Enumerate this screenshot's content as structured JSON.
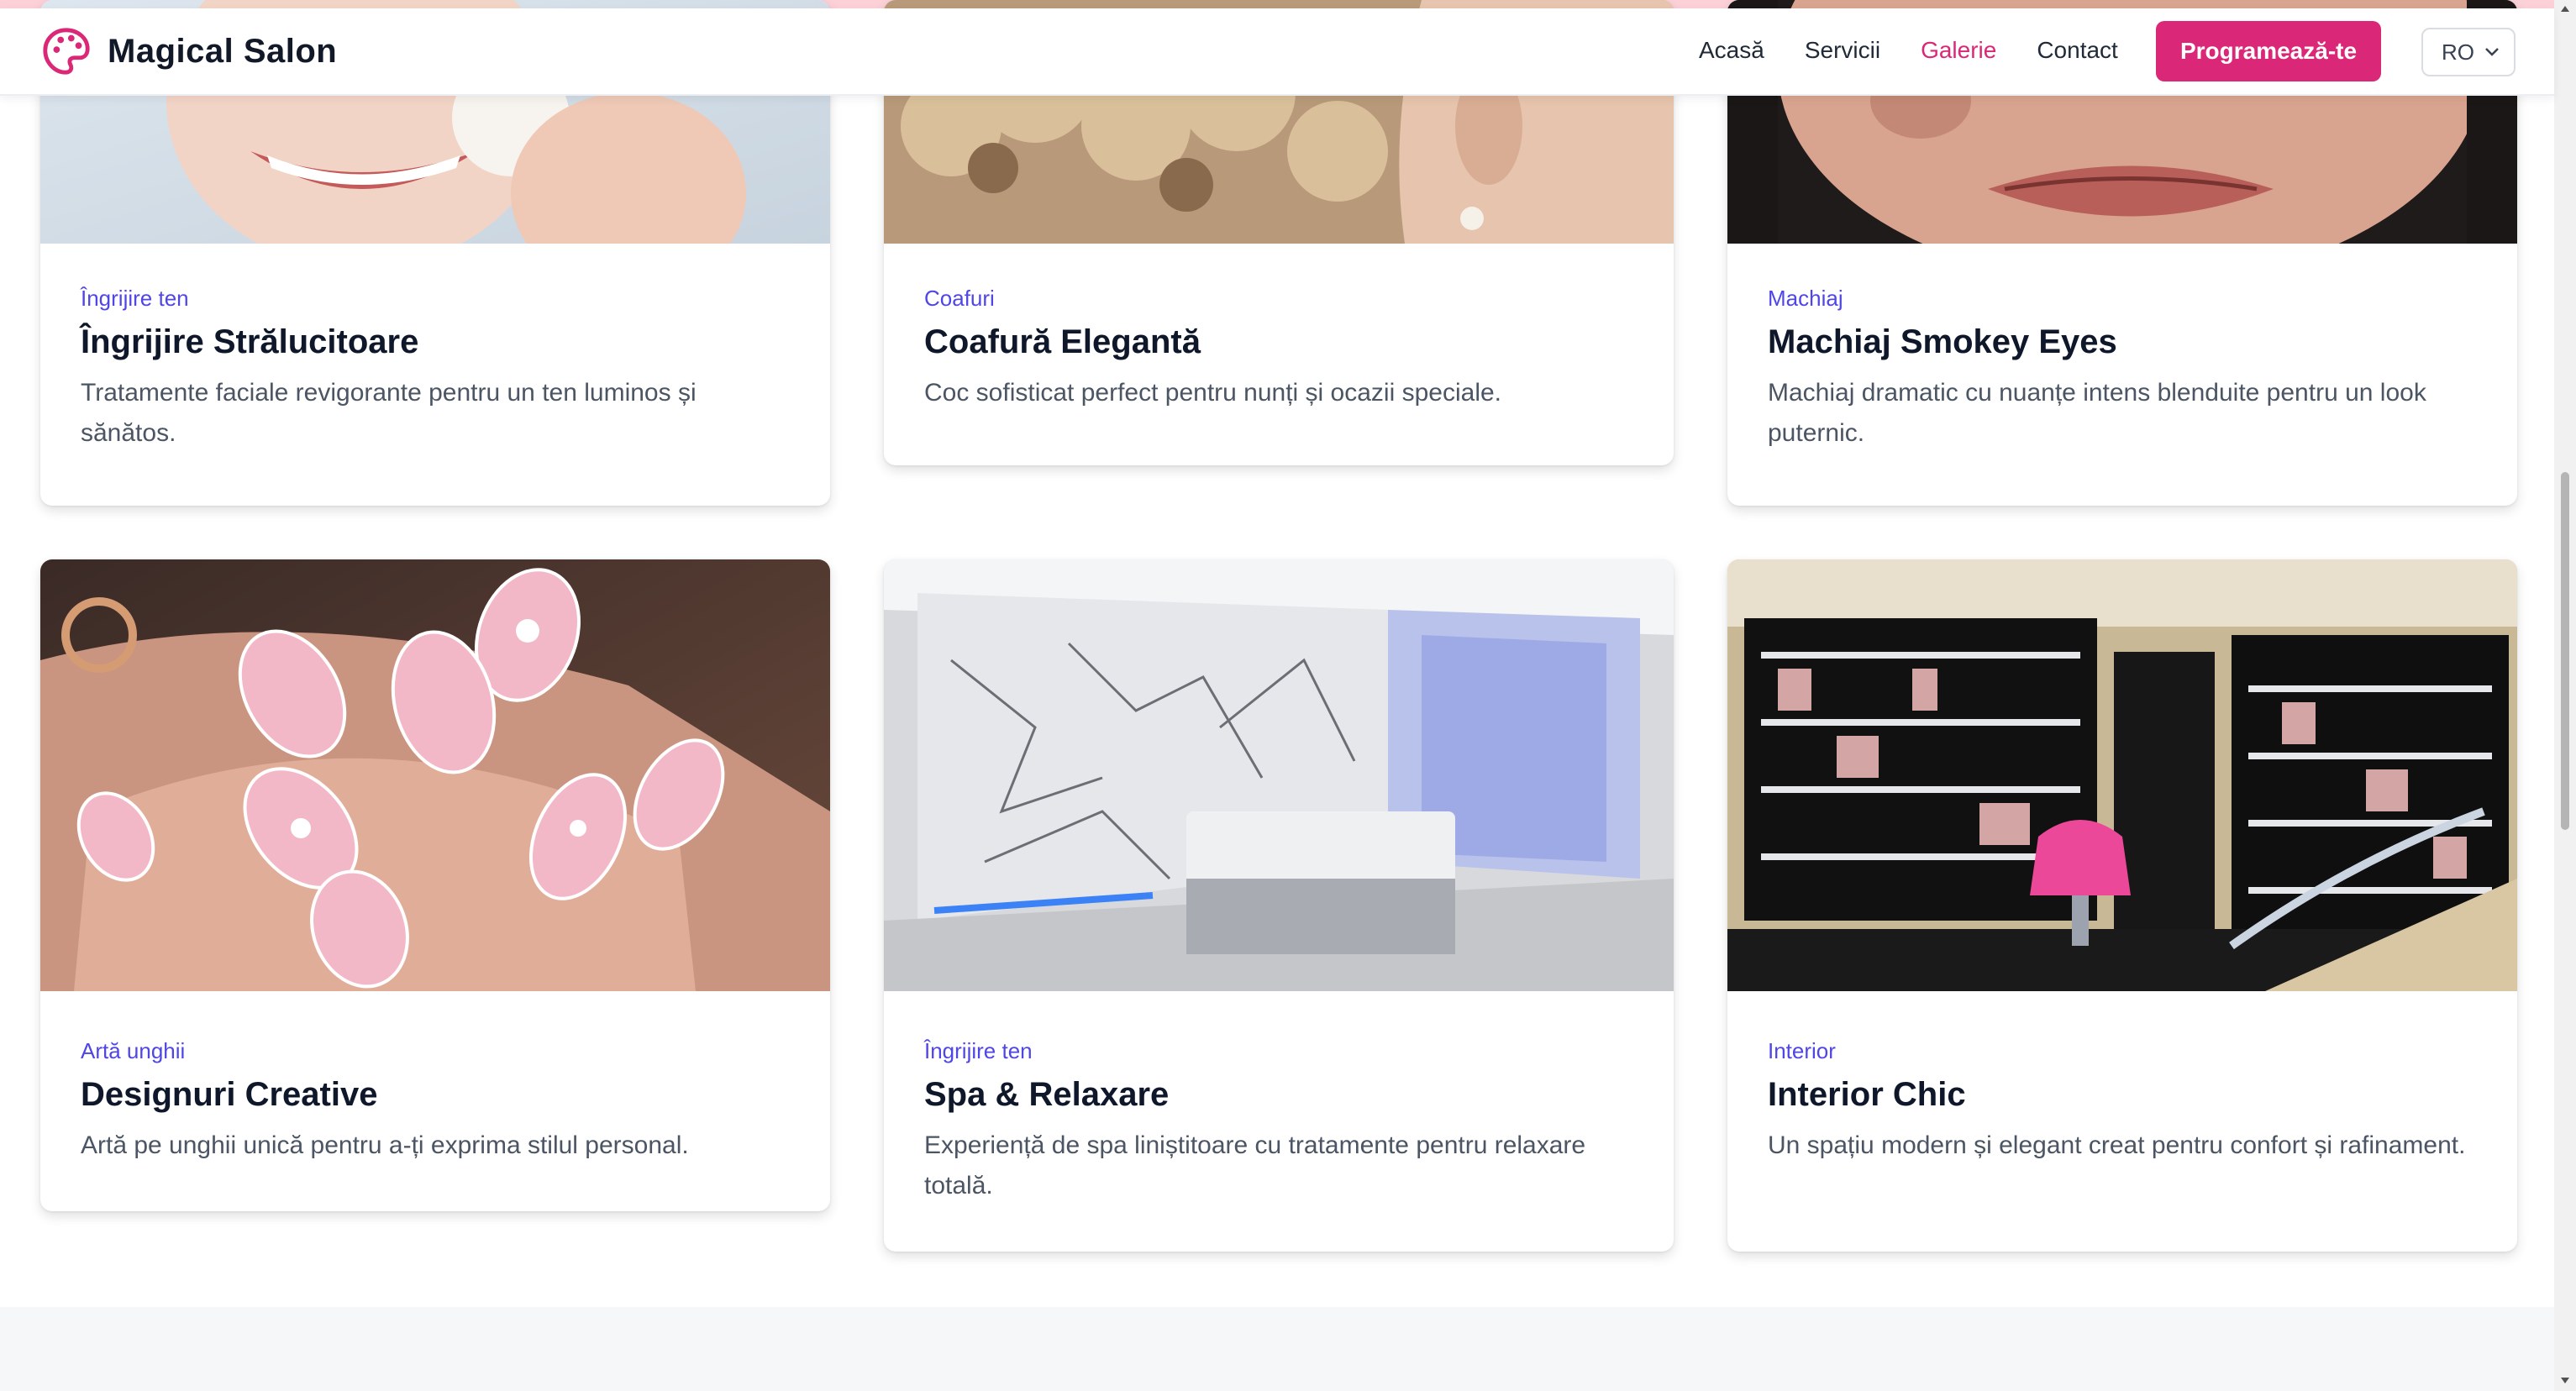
{
  "brand": {
    "name": "Magical Salon",
    "accent": "#db2777"
  },
  "nav": {
    "links": [
      "Acasă",
      "Servicii",
      "Galerie",
      "Contact"
    ],
    "active_index": 2,
    "cta_label": "Programează-te",
    "language": "RO"
  },
  "gallery": [
    {
      "category": "Îngrijire ten",
      "title": "Îngrijire Strălucitoare",
      "description": "Tratamente faciale revigorante pentru un ten luminos și sănătos.",
      "image": "face-care-photo"
    },
    {
      "category": "Coafuri",
      "title": "Coafură Elegantă",
      "description": "Coc sofisticat perfect pentru nunți și ocazii speciale.",
      "image": "updo-hair-photo"
    },
    {
      "category": "Machiaj",
      "title": "Machiaj Smokey Eyes",
      "description": "Machiaj dramatic cu nuanțe intens blenduite pentru un look puternic.",
      "image": "lips-makeup-photo"
    },
    {
      "category": "Artă unghii",
      "title": "Designuri Creative",
      "description": "Artă pe unghii unică pentru a-ți exprima stilul personal.",
      "image": "pink-nails-photo"
    },
    {
      "category": "Îngrijire ten",
      "title": "Spa & Relaxare",
      "description": "Experiență de spa liniștitoare cu tratamente pentru relaxare totală.",
      "image": "spa-room-photo"
    },
    {
      "category": "Interior",
      "title": "Interior Chic",
      "description": "Un spațiu modern și elegant creat pentru confort și rafinament.",
      "image": "salon-interior-photo"
    }
  ],
  "colors": {
    "category": "#4f46e5",
    "text": "#4b5563",
    "heading": "#0f172a"
  }
}
